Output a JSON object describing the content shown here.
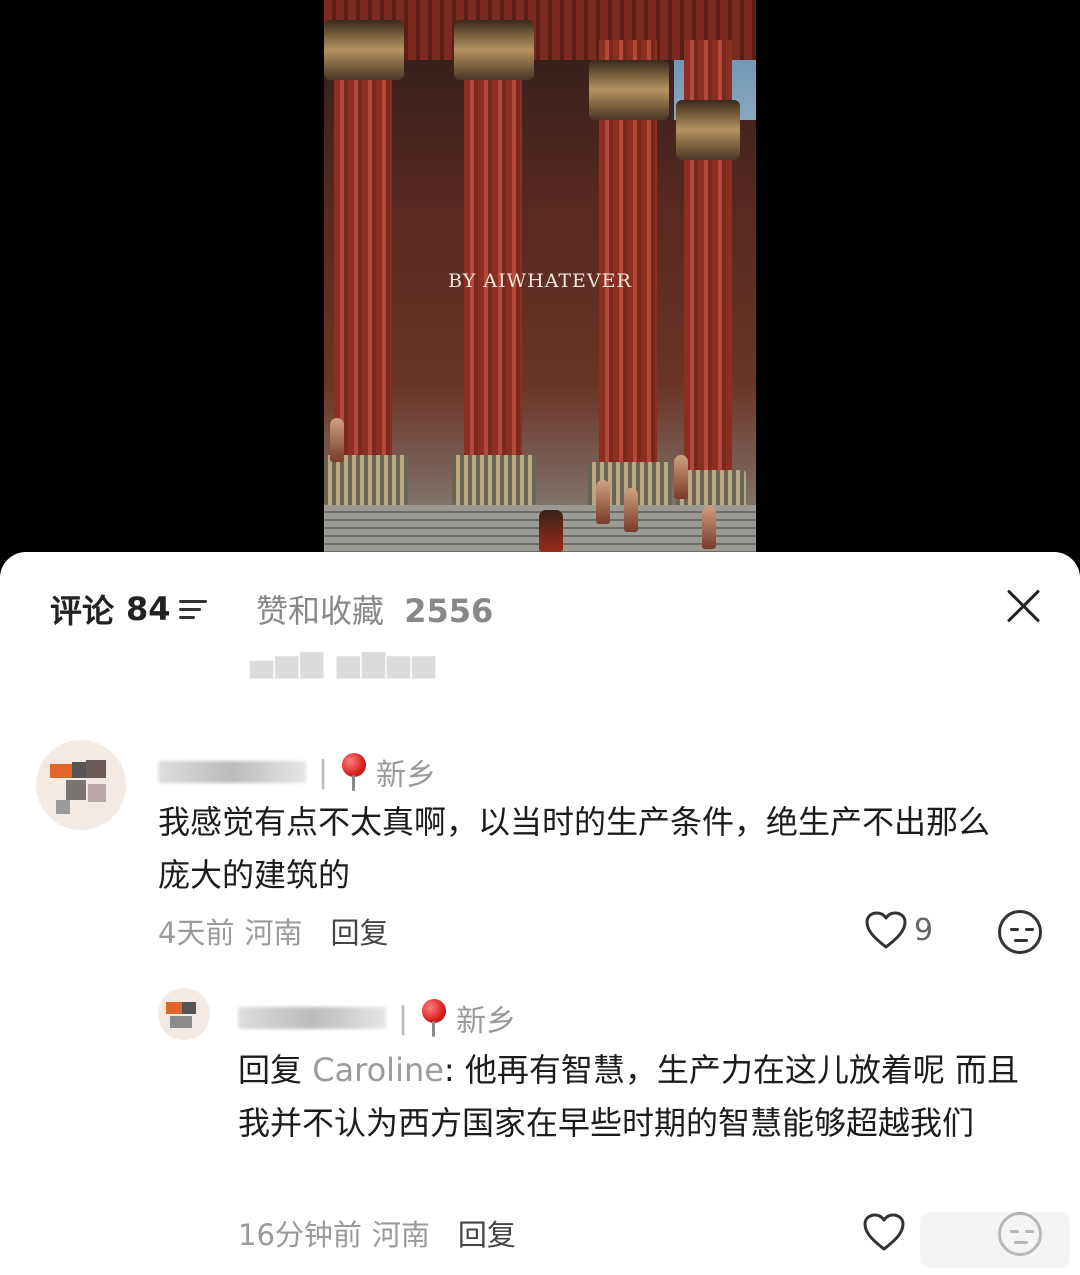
{
  "video": {
    "watermark": "BY AIWHATEVER"
  },
  "tabs": {
    "comments_label": "评论",
    "comments_count": "84",
    "likes_label": "赞和收藏",
    "likes_count": "2556"
  },
  "comments": [
    {
      "location": "新乡",
      "text": "我感觉有点不太真啊，以当时的生产条件，绝生产不出那么庞大的建筑的",
      "time": "4天前",
      "region": "河南",
      "reply_label": "回复",
      "likes": "9"
    },
    {
      "location": "新乡",
      "reply_prefix": "回复",
      "mention": "Caroline",
      "text": ": 他再有智慧，生产力在这儿放着呢  而且我并不认为西方国家在早些时期的智慧能够超越我们",
      "time": "16分钟前",
      "region": "河南",
      "reply_label": "回复"
    }
  ]
}
